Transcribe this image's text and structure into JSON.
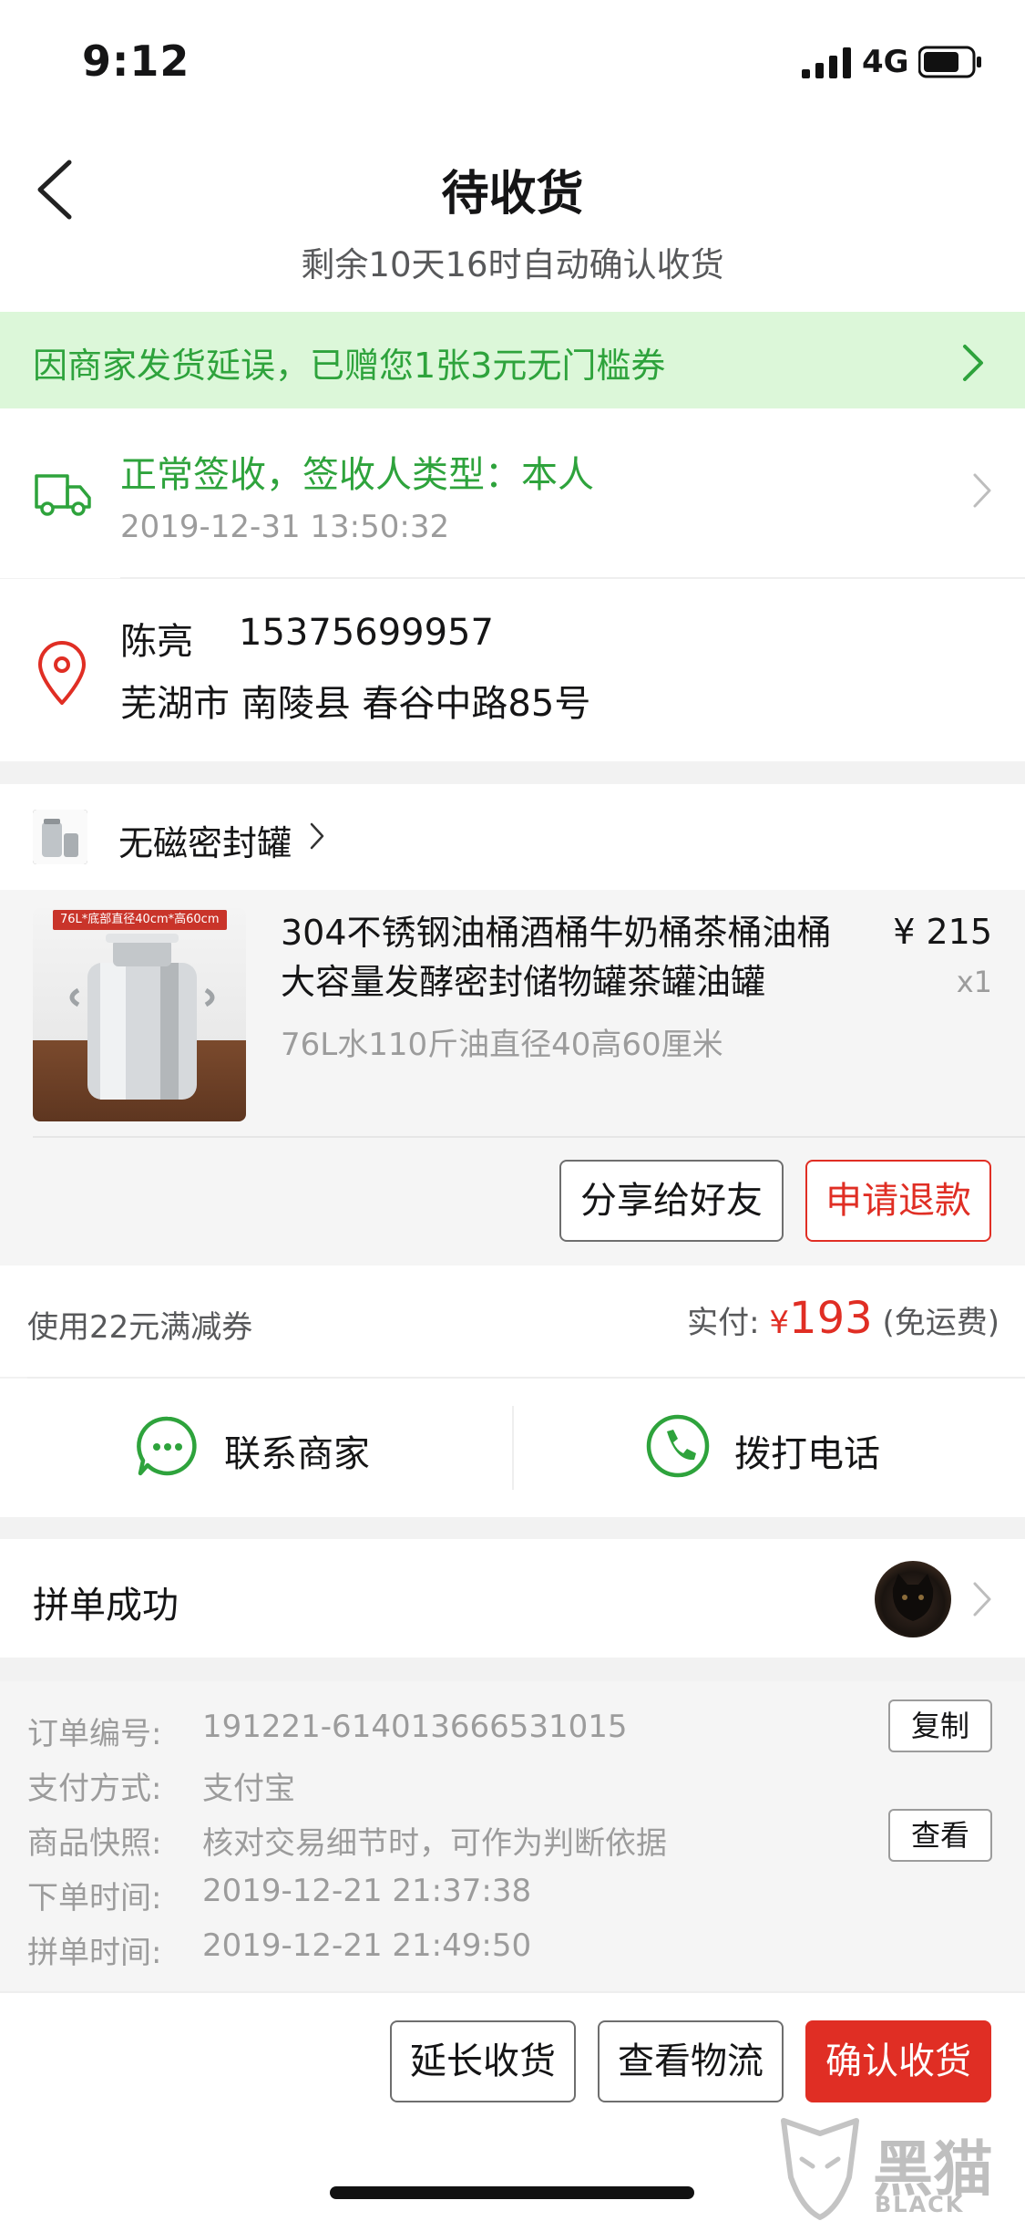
{
  "status_bar": {
    "time": "9:12",
    "network": "4G"
  },
  "header": {
    "title": "待收货",
    "subtitle": "剩余10天16时自动确认收货"
  },
  "banner": {
    "text": "因商家发货延误，已赠您1张3元无门槛券"
  },
  "logistics": {
    "status": "正常签收，签收人类型：本人",
    "time": "2019-12-31 13:50:32"
  },
  "address": {
    "name": "陈亮",
    "phone": "15375699957",
    "line": "芜湖市 南陵县 春谷中路85号"
  },
  "store": {
    "name": "无磁密封罐"
  },
  "product": {
    "image_tag": "76L*底部直径40cm*高60cm",
    "title": "304不锈钢油桶酒桶牛奶桶茶桶油桶大容量发酵密封储物罐茶罐油罐",
    "price": "¥ 215",
    "quantity": "x1",
    "spec": "76L水110斤油直径40高60厘米",
    "share_label": "分享给好友",
    "refund_label": "申请退款"
  },
  "payment": {
    "coupon": "使用22元满减券",
    "paid_label": "实付:",
    "currency": "¥",
    "amount": "193",
    "shipping": "(免运费)"
  },
  "contact": {
    "merchant_label": "联系商家",
    "call_label": "拨打电话"
  },
  "group": {
    "text": "拼单成功"
  },
  "order_info": {
    "rows": [
      {
        "key": "订单编号:",
        "value": "191221-614013666531015"
      },
      {
        "key": "支付方式:",
        "value": "支付宝"
      },
      {
        "key": "商品快照:",
        "value": "核对交易细节时，可作为判断依据"
      },
      {
        "key": "下单时间:",
        "value": "2019-12-21 21:37:38"
      },
      {
        "key": "拼单时间:",
        "value": "2019-12-21 21:49:50"
      }
    ],
    "copy_label": "复制",
    "view_label": "查看"
  },
  "bottom_bar": {
    "extend_label": "延长收货",
    "logistics_label": "查看物流",
    "confirm_label": "确认收货"
  },
  "watermark": {
    "text": "黑猫",
    "sub": "BLACK CAT"
  },
  "colors": {
    "accent_red": "#e02e24",
    "accent_green": "#2ea33c",
    "banner_bg": "#dcf7d9"
  }
}
